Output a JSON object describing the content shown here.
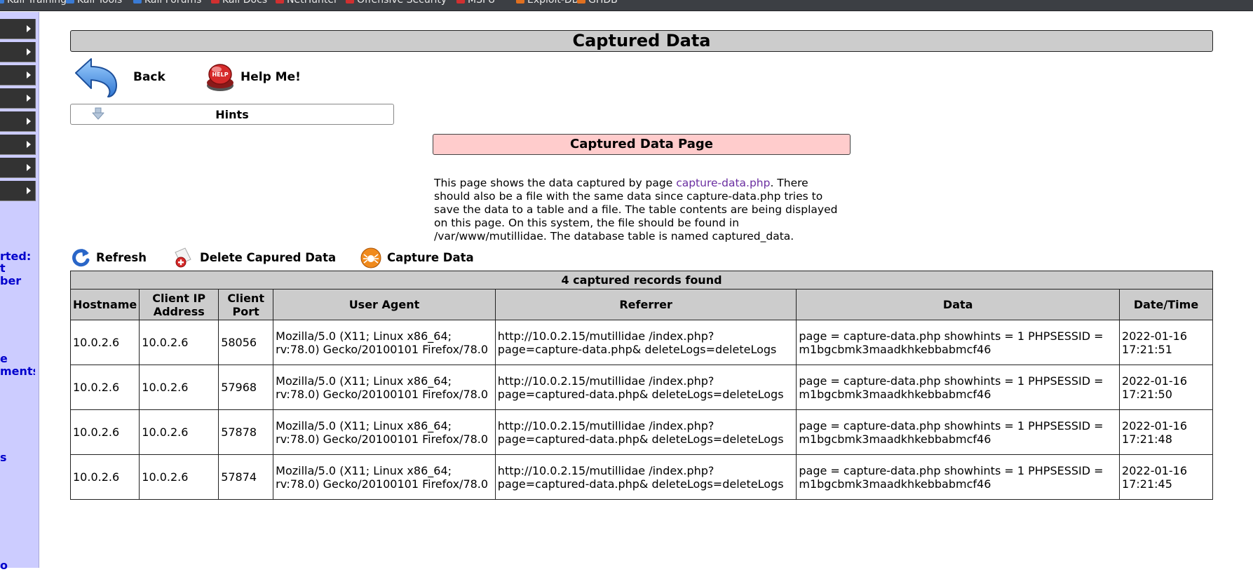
{
  "bookmarks": [
    {
      "label": "Kali Training",
      "icon": "kali-training-icon",
      "color": "#3a7bd5"
    },
    {
      "label": "Kali Tools",
      "icon": "kali-tools-icon",
      "color": "#3a7bd5"
    },
    {
      "label": "Kali Forums",
      "icon": "kali-forums-icon",
      "color": "#3a7bd5"
    },
    {
      "label": "Kali Docs",
      "icon": "kali-docs-icon",
      "color": "#d03030"
    },
    {
      "label": "NetHunter",
      "icon": "nethunter-icon",
      "color": "#d03030"
    },
    {
      "label": "Offensive Security",
      "icon": "offsec-icon",
      "color": "#d03030"
    },
    {
      "label": "MSFU",
      "icon": "msfu-icon",
      "color": "#d03030"
    },
    {
      "label": "Exploit-DB",
      "icon": "exploitdb-icon",
      "color": "#e07020"
    },
    {
      "label": "GHDB",
      "icon": "ghdb-icon",
      "color": "#e07020"
    }
  ],
  "sidebar": {
    "menu_count": 8,
    "text_fragments": [
      "rted:",
      "t",
      "ber",
      "e",
      "ments",
      "s",
      "o"
    ]
  },
  "page": {
    "title": "Captured Data",
    "back_label": "Back",
    "help_label": "Help Me!",
    "hints_label": "Hints",
    "header_box": "Captured Data Page",
    "description": {
      "before_link": "This page shows the data captured by page ",
      "link_text": "capture-data.php",
      "after_link": ". There should also be a file with the same data since capture-data.php tries to save the data to a table and a file. The table contents are being displayed on this page. On this system, the file should be found in /var/www/mutillidae. The database table is named captured_data."
    }
  },
  "actions": {
    "refresh": "Refresh",
    "delete": "Delete Capured Data",
    "capture": "Capture Data"
  },
  "table": {
    "caption": "4 captured records found",
    "columns": {
      "hostname": "Hostname",
      "client_ip": "Client IP Address",
      "client_port": "Client Port",
      "user_agent": "User Agent",
      "referrer": "Referrer",
      "data": "Data",
      "datetime": "Date/Time"
    },
    "rows": [
      {
        "hostname": "10.0.2.6",
        "client_ip": "10.0.2.6",
        "client_port": "58056",
        "user_agent": "Mozilla/5.0 (X11; Linux x86_64; rv:78.0) Gecko/20100101 Firefox/78.0",
        "referrer": "http://10.0.2.15/mutillidae /index.php?page=capture-data.php& deleteLogs=deleteLogs",
        "data": "page = capture-data.php showhints = 1 PHPSESSID = m1bgcbmk3maadkhkebbabmcf46",
        "datetime": "2022-01-16 17:21:51"
      },
      {
        "hostname": "10.0.2.6",
        "client_ip": "10.0.2.6",
        "client_port": "57968",
        "user_agent": "Mozilla/5.0 (X11; Linux x86_64; rv:78.0) Gecko/20100101 Firefox/78.0",
        "referrer": "http://10.0.2.15/mutillidae /index.php?page=captured-data.php& deleteLogs=deleteLogs",
        "data": "page = capture-data.php showhints = 1 PHPSESSID = m1bgcbmk3maadkhkebbabmcf46",
        "datetime": "2022-01-16 17:21:50"
      },
      {
        "hostname": "10.0.2.6",
        "client_ip": "10.0.2.6",
        "client_port": "57878",
        "user_agent": "Mozilla/5.0 (X11; Linux x86_64; rv:78.0) Gecko/20100101 Firefox/78.0",
        "referrer": "http://10.0.2.15/mutillidae /index.php?page=captured-data.php& deleteLogs=deleteLogs",
        "data": "page = capture-data.php showhints = 1 PHPSESSID = m1bgcbmk3maadkhkebbabmcf46",
        "datetime": "2022-01-16 17:21:48"
      },
      {
        "hostname": "10.0.2.6",
        "client_ip": "10.0.2.6",
        "client_port": "57874",
        "user_agent": "Mozilla/5.0 (X11; Linux x86_64; rv:78.0) Gecko/20100101 Firefox/78.0",
        "referrer": "http://10.0.2.15/mutillidae /index.php?page=captured-data.php& deleteLogs=deleteLogs",
        "data": "page = capture-data.php showhints = 1 PHPSESSID = m1bgcbmk3maadkhkebbabmcf46",
        "datetime": "2022-01-16 17:21:45"
      }
    ]
  }
}
